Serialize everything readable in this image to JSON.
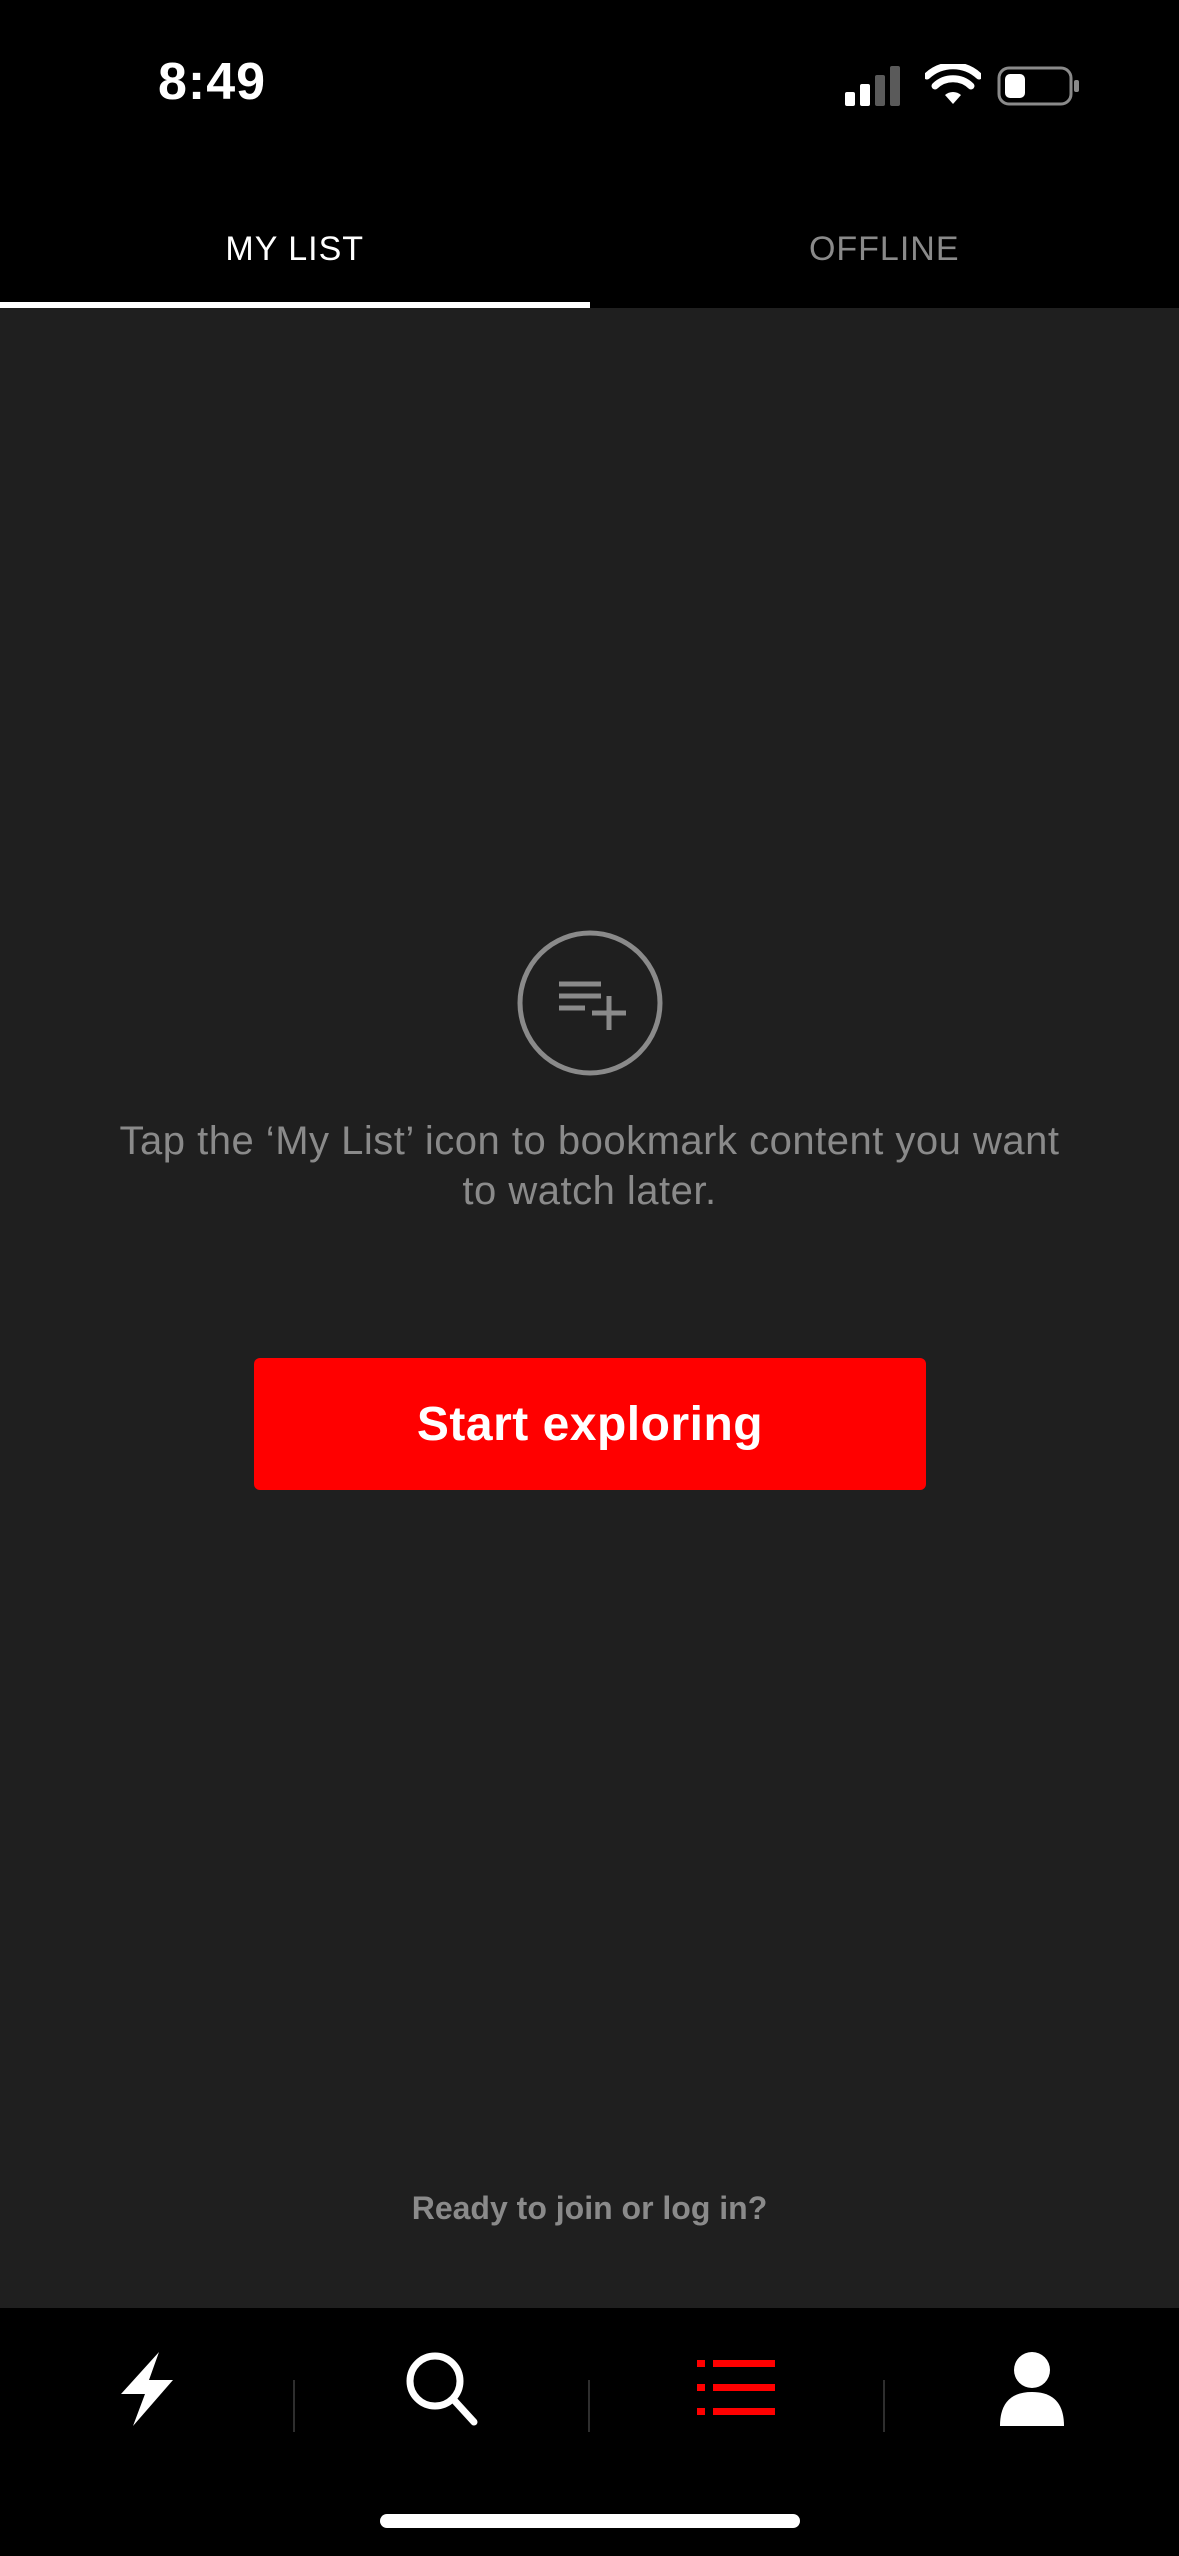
{
  "status_bar": {
    "time": "8:49"
  },
  "tabs": [
    {
      "label": "MY LIST",
      "active": true
    },
    {
      "label": "OFFLINE",
      "active": false
    }
  ],
  "empty_state": {
    "icon": "playlist-add-icon",
    "message": "Tap the ‘My List’ icon to bookmark content you want to watch later."
  },
  "cta": {
    "label": "Start exploring",
    "color": "#ff0000"
  },
  "join_prompt": "Ready to join or log in?",
  "bottom_nav": [
    {
      "name": "lightning-icon",
      "active": false
    },
    {
      "name": "search-icon",
      "active": false
    },
    {
      "name": "list-icon",
      "active": true,
      "color": "#ff0000"
    },
    {
      "name": "profile-icon",
      "active": false
    }
  ]
}
